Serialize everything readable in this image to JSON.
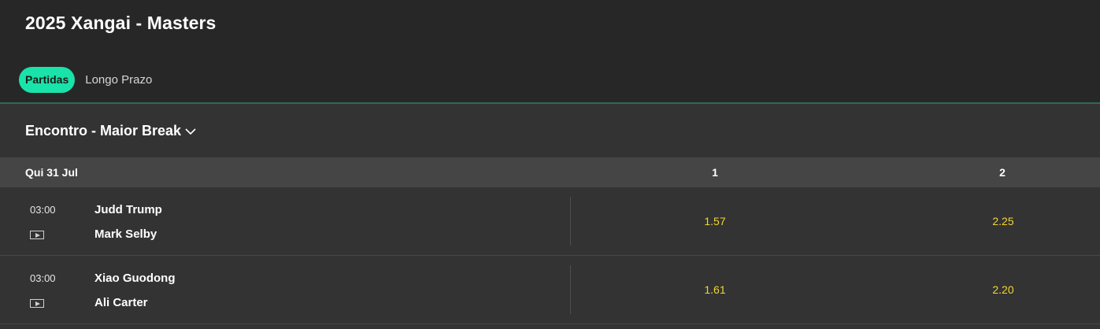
{
  "header": {
    "title": "2025 Xangai - Masters",
    "tabs": [
      {
        "label": "Partidas",
        "active": true
      },
      {
        "label": "Longo Prazo",
        "active": false
      }
    ]
  },
  "market": {
    "title": "Encontro - Maior Break",
    "icon": "chevron-down-icon"
  },
  "day": {
    "label": "Qui 31 Jul",
    "col1": "1",
    "col2": "2"
  },
  "matches": [
    {
      "time": "03:00",
      "team_a": "Judd Trump",
      "team_b": "Mark Selby",
      "odd_1": "1.57",
      "odd_2": "2.25"
    },
    {
      "time": "03:00",
      "team_a": "Xiao Guodong",
      "team_b": "Ali Carter",
      "odd_1": "1.61",
      "odd_2": "2.20"
    }
  ],
  "colors": {
    "accent": "#19e3a8",
    "odds": "#f2d433",
    "header_bg": "#272727",
    "row_bg": "#333333",
    "day_bg": "#454545"
  }
}
